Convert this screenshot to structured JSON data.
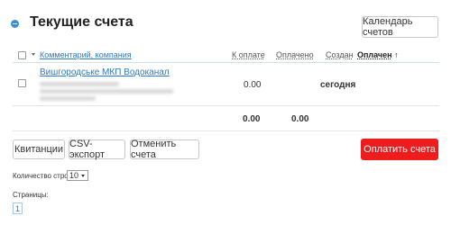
{
  "panel": {
    "title": "Текущие счета",
    "calendar_button": "Календарь счетов"
  },
  "table": {
    "headers": {
      "comment_company": "Комментарий, компания",
      "to_pay": "К оплате",
      "paid": "Оплачено",
      "created": "Создан",
      "paid_status": "Оплачен",
      "sort_arrow": "↑"
    },
    "rows": [
      {
        "company": "Вишгородське МКП Водоканал",
        "to_pay": "0.00",
        "paid": "",
        "created": "сегодня",
        "paid_status": ""
      }
    ],
    "totals": {
      "to_pay": "0.00",
      "paid": "0.00"
    }
  },
  "actions": {
    "receipts": "Квитанции",
    "csv_export": "CSV-экспорт",
    "cancel_invoices": "Отменить счета",
    "pay_invoices": "Оплатить счета",
    "pay_color": "#ee1c1c"
  },
  "pagination": {
    "rows_label": "Количество строк:",
    "rows_value": "10",
    "pages_label": "Страницы:",
    "pages": [
      "1"
    ]
  }
}
